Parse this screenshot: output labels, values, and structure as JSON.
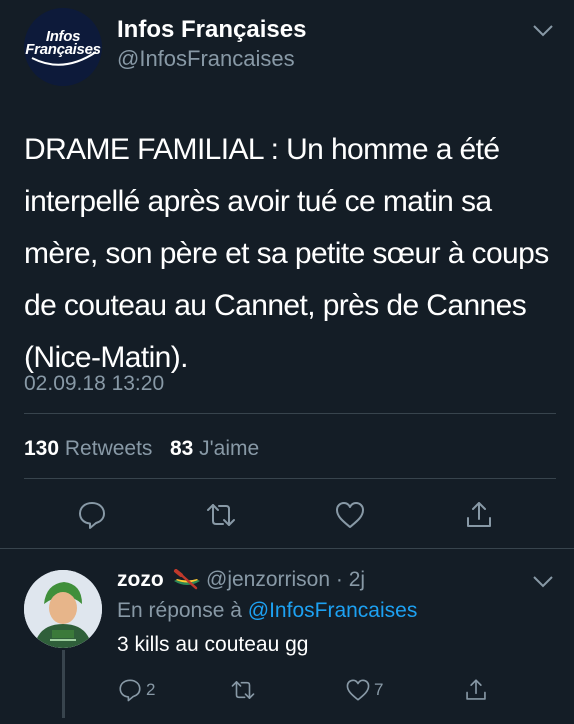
{
  "tweet": {
    "account_name": "Infos Françaises",
    "handle": "@InfosFrancaises",
    "avatar_text_line1": "Infos",
    "avatar_text_line2": "Françaises",
    "text": "DRAME FAMILIAL : Un homme a été interpellé après avoir tué ce matin sa mère, son père et sa petite sœur à coups de couteau au Cannet, près de Cannes (Nice-Matin).",
    "timestamp": "02.09.18 13:20",
    "retweets_count": "130",
    "retweets_label": "Retweets",
    "likes_count": "83",
    "likes_label": "J'aime"
  },
  "actions": [
    "reply-icon",
    "retweet-icon",
    "like-icon",
    "share-icon"
  ],
  "reply": {
    "name": "zozo",
    "handle_time": "@jenzorrison · 2j",
    "in_reply_prefix": "En réponse à",
    "in_reply_mention": "@InfosFrancaises",
    "text": "3 kills au couteau gg",
    "reply_count": "2",
    "retweet_count": "",
    "like_count": "7"
  },
  "colors": {
    "background": "#141d26",
    "secondary_text": "#8899a6",
    "link": "#1da1f2",
    "divider": "#38444d"
  }
}
